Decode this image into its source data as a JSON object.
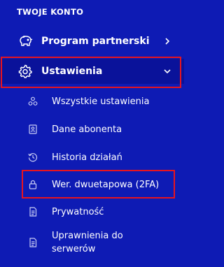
{
  "sidebar": {
    "section_title": "TWOJE KONTO",
    "items": [
      {
        "label": "Program partnerski",
        "icon": "piggy-bank-icon",
        "trail_icon": "chevron-right-icon"
      },
      {
        "label": "Ustawienia",
        "icon": "gear-icon",
        "trail_icon": "chevron-down-icon",
        "active": true
      }
    ],
    "subitems": [
      {
        "label": "Wszystkie ustawienia",
        "icon": "settings-cluster-icon"
      },
      {
        "label": "Dane abonenta",
        "icon": "contact-card-icon"
      },
      {
        "label": "Historia działań",
        "icon": "history-icon"
      },
      {
        "label": "Wer. dwuetapowa (2FA)",
        "icon": "lock-icon"
      },
      {
        "label": "Prywatność",
        "icon": "document-icon"
      },
      {
        "label_line1": "Uprawnienia do",
        "label_line2": "serwerów",
        "icon": "document-icon"
      }
    ]
  },
  "colors": {
    "background": "#0e1bb4",
    "active_background": "#0a129a",
    "highlight": "#e8141e",
    "text": "#ffffff"
  }
}
